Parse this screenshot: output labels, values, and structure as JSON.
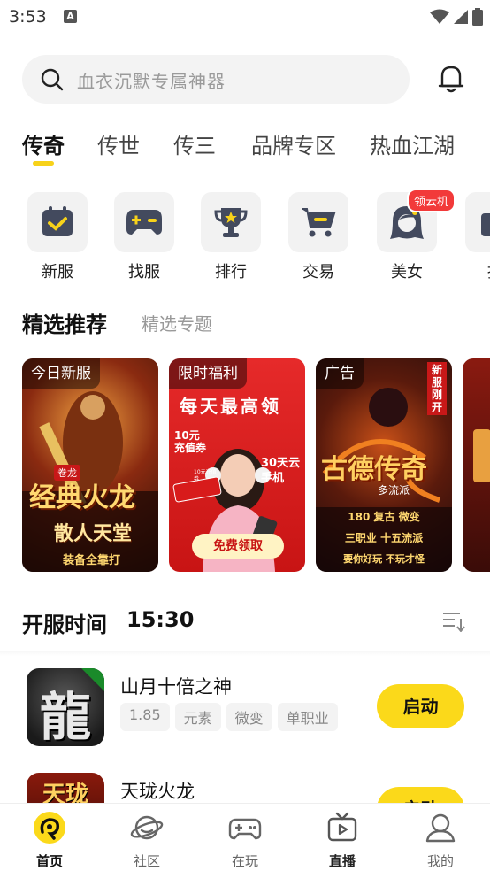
{
  "status_bar": {
    "time": "3:53",
    "notif_letter": "A"
  },
  "search": {
    "placeholder": "血衣沉默专属神器"
  },
  "tabs": [
    {
      "label": "传奇",
      "active": true
    },
    {
      "label": "传世",
      "active": false
    },
    {
      "label": "传三",
      "active": false
    },
    {
      "label": "品牌专区",
      "active": false
    },
    {
      "label": "热血江湖",
      "active": false
    }
  ],
  "quick_actions": [
    {
      "label": "新服",
      "icon": "calendar-check-icon"
    },
    {
      "label": "找服",
      "icon": "gamepad-icon"
    },
    {
      "label": "排行",
      "icon": "trophy-icon"
    },
    {
      "label": "交易",
      "icon": "cart-icon"
    },
    {
      "label": "美女",
      "icon": "girl-icon",
      "badge": "领云机"
    },
    {
      "label": "抽",
      "icon": "gift-icon"
    }
  ],
  "featured": {
    "title": "精选推荐",
    "subtitle": "精选专题",
    "cards": [
      {
        "tag": "今日新服",
        "art_text": {
          "label": "卷龙",
          "title": "经典火龙",
          "subtitle": "散人天堂",
          "footer": "装备全靠打"
        }
      },
      {
        "tag": "限时福利",
        "art_text": {
          "headline": "每天最高领",
          "coupon": "10元充值券",
          "phone": "30天云手机",
          "cta": "免费领取",
          "voucher_small": "10元充值券"
        }
      },
      {
        "tag": "广告",
        "art_text": {
          "corner": "新服刚开",
          "title": "古德传奇",
          "subtitle": "多流派",
          "line1": "180 复古 微变",
          "line2": "三职业 十五流派",
          "line3": "要你好玩 不玩才怪"
        }
      },
      {
        "tag": "",
        "art_text": {}
      }
    ]
  },
  "open_servers": {
    "title": "开服时间",
    "time": "15:30",
    "games": [
      {
        "name": "山月十倍之神",
        "tags": [
          "1.85",
          "元素",
          "微变",
          "单职业"
        ],
        "button": "启动",
        "icon_text": "龍"
      },
      {
        "name": "天珑火龙",
        "tags": [],
        "button": "启动",
        "icon_text": "天珑"
      }
    ]
  },
  "bottom_nav": [
    {
      "label": "首页",
      "active": true,
      "icon": "home-icon"
    },
    {
      "label": "社区",
      "active": false,
      "icon": "planet-icon"
    },
    {
      "label": "在玩",
      "active": false,
      "icon": "gamepad-icon"
    },
    {
      "label": "直播",
      "active": false,
      "icon": "tv-icon"
    },
    {
      "label": "我的",
      "active": false,
      "icon": "user-icon"
    }
  ],
  "colors": {
    "accent": "#fbd91a",
    "badge": "#f23a3a"
  }
}
